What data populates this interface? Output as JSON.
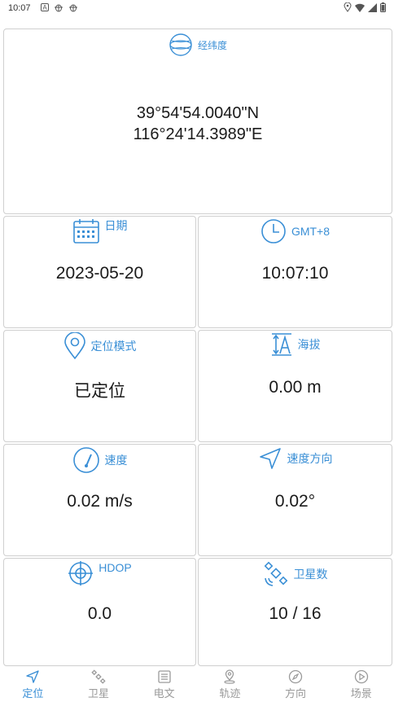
{
  "status_bar": {
    "time": "10:07",
    "left_icons": [
      "a-icon",
      "bug-icon",
      "bug-icon"
    ],
    "right_icons": [
      "location-icon",
      "wifi-icon",
      "signal-icon",
      "battery-icon"
    ]
  },
  "latlon": {
    "title": "经纬度",
    "lat": "39°54'54.0040\"N",
    "lon": "116°24'14.3989\"E"
  },
  "cells": {
    "date": {
      "title": "日期",
      "value": "2023-05-20",
      "icon": "calendar-icon"
    },
    "gmt": {
      "title": "GMT+8",
      "value": "10:07:10",
      "icon": "clock-icon"
    },
    "mode": {
      "title": "定位模式",
      "value": "已定位",
      "icon": "location-pin-icon"
    },
    "altitude": {
      "title": "海拔",
      "value": "0.00 m",
      "icon": "altitude-icon"
    },
    "speed": {
      "title": "速度",
      "value": "0.02 m/s",
      "icon": "speedometer-icon"
    },
    "heading": {
      "title": "速度方向",
      "value": "0.02°",
      "icon": "navigation-arrow-icon"
    },
    "hdop": {
      "title": "HDOP",
      "value": "0.0",
      "icon": "crosshair-icon"
    },
    "satellites": {
      "title": "卫星数",
      "value": "10 / 16",
      "icon": "satellite-icon"
    }
  },
  "nav": {
    "active": "定位",
    "items": [
      {
        "label": "定位",
        "icon": "navigation-icon"
      },
      {
        "label": "卫星",
        "icon": "satellite-icon"
      },
      {
        "label": "电文",
        "icon": "document-icon"
      },
      {
        "label": "轨迹",
        "icon": "map-pin-icon"
      },
      {
        "label": "方向",
        "icon": "compass-icon"
      },
      {
        "label": "场景",
        "icon": "play-icon"
      }
    ]
  },
  "colors": {
    "accent": "#3a8fd6",
    "inactive": "#9a9a9a",
    "border": "#cfcfcf"
  }
}
